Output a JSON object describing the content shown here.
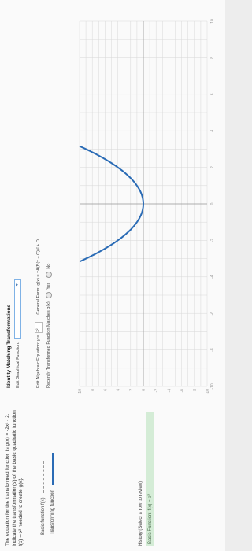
{
  "prompt": {
    "text": "The equation for the transformed function is g(x) = -2x² - 2. Indicate the transformation(s) of the basic quadratic function f(x) = x² needed to create g(x)."
  },
  "legend": {
    "basic_label": "Basic function f(x)",
    "transforming_label": "Transforming function"
  },
  "history": {
    "title": "History (Select a row to review)",
    "item": "Basic Function: f(x) = x²"
  },
  "right": {
    "title": "Identity Matching Transformations",
    "edit_label": "Edit Graphical Function:",
    "dropdown_value": "",
    "alg_label": "Edit Algebraic Equation: y =",
    "alg_value": "x²",
    "general_form": "General Form: g(x) = ±A(B(x − C))² + D",
    "match_label": "Recently Transformed Function Matches g(x):",
    "yes": "Yes",
    "no": "No"
  },
  "graph": {
    "accent": "#2a6bb5",
    "grid_color": "#d8d8d8",
    "x_range": [
      -10,
      10
    ],
    "y_range": [
      -10,
      10
    ],
    "x_ticks": [
      "-10",
      "-8",
      "-6",
      "-4",
      "-2",
      "0",
      "2",
      "4",
      "6",
      "8",
      "10"
    ],
    "y_ticks": [
      "10",
      "8",
      "6",
      "4",
      "2",
      "0",
      "-2",
      "-4",
      "-6",
      "-8",
      "-10"
    ],
    "curve": "y = x²"
  }
}
